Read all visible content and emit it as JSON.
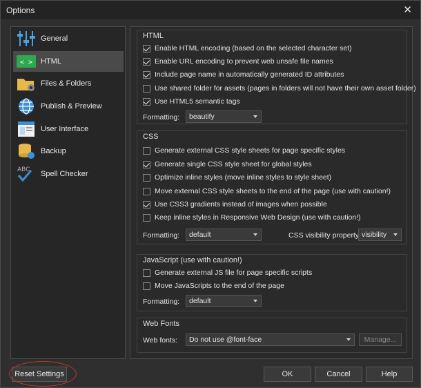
{
  "window": {
    "title": "Options"
  },
  "sidebar": {
    "items": [
      {
        "label": "General",
        "icon": "sliders-icon",
        "active": false
      },
      {
        "label": "HTML",
        "icon": "code-icon",
        "active": true
      },
      {
        "label": "Files & Folders",
        "icon": "folder-gear-icon",
        "active": false
      },
      {
        "label": "Publish & Preview",
        "icon": "globe-icon",
        "active": false
      },
      {
        "label": "User Interface",
        "icon": "window-icon",
        "active": false
      },
      {
        "label": "Backup",
        "icon": "database-icon",
        "active": false
      },
      {
        "label": "Spell Checker",
        "icon": "abc-check-icon",
        "active": false
      }
    ]
  },
  "html_group": {
    "title": "HTML",
    "options": [
      {
        "label": "Enable HTML encoding (based on the selected character set)",
        "checked": true
      },
      {
        "label": "Enable URL encoding to prevent web unsafe file names",
        "checked": true
      },
      {
        "label": "Include page name in automatically generated ID attributes",
        "checked": true
      },
      {
        "label": "Use shared folder for assets (pages in folders will not have their own asset folder)",
        "checked": false
      },
      {
        "label": "Use HTML5 semantic tags",
        "checked": true
      }
    ],
    "formatting_label": "Formatting:",
    "formatting_value": "beautify"
  },
  "css_group": {
    "title": "CSS",
    "options": [
      {
        "label": "Generate external CSS style sheets for page specific styles",
        "checked": false
      },
      {
        "label": "Generate single CSS style sheet for global styles",
        "checked": true
      },
      {
        "label": "Optimize inline styles (move inline styles to style sheet)",
        "checked": false
      },
      {
        "label": "Move external CSS style sheets to the end of the page (use with caution!)",
        "checked": false
      },
      {
        "label": "Use CSS3 gradients instead of images when possible",
        "checked": true
      },
      {
        "label": "Keep inline styles in Responsive Web Design (use with caution!)",
        "checked": false
      }
    ],
    "formatting_label": "Formatting:",
    "formatting_value": "default",
    "visibility_label": "CSS visibility property:",
    "visibility_value": "visibility"
  },
  "js_group": {
    "title": "JavaScript (use with caution!)",
    "options": [
      {
        "label": "Generate external JS file for page specific scripts",
        "checked": false
      },
      {
        "label": "Move JavaScripts to the end of the page",
        "checked": false
      }
    ],
    "formatting_label": "Formatting:",
    "formatting_value": "default"
  },
  "fonts_group": {
    "title": "Web Fonts",
    "webfonts_label": "Web fonts:",
    "webfonts_value": "Do not use @font-face",
    "manage_label": "Manage..."
  },
  "footer": {
    "reset_label": "Reset Settings",
    "ok_label": "OK",
    "cancel_label": "Cancel",
    "help_label": "Help"
  },
  "colors": {
    "highlight_ring": "#c0392b",
    "sidebar_active": "#4a4a4a"
  }
}
